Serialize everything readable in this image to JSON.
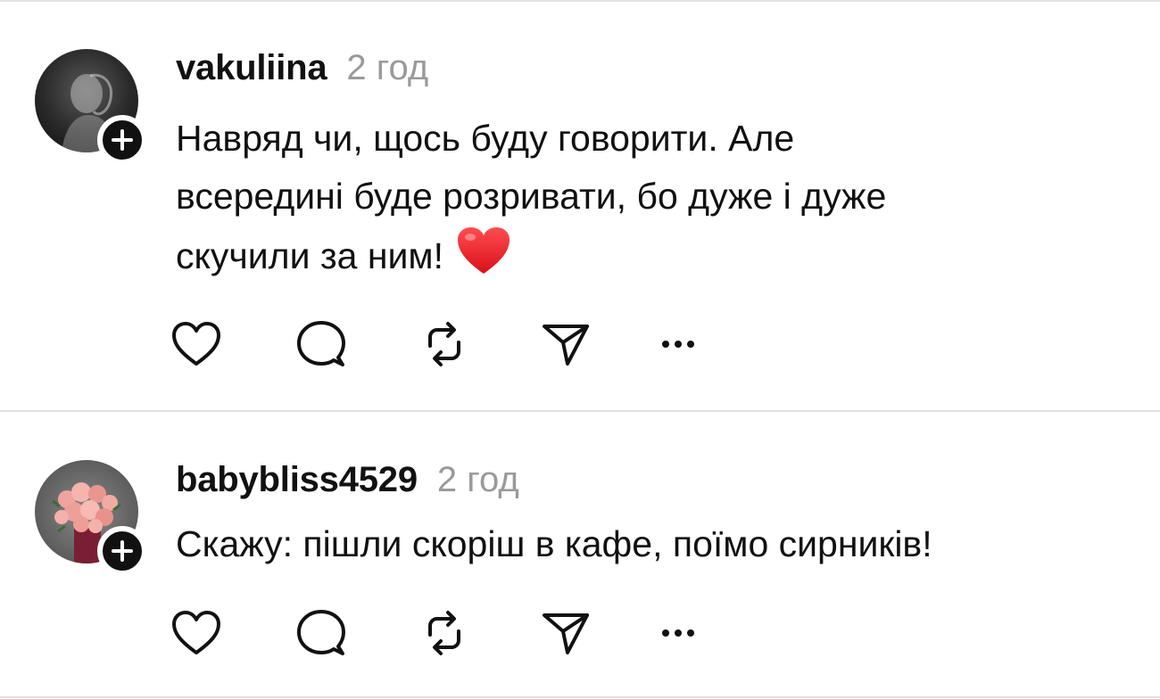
{
  "posts": [
    {
      "username": "vakuliina",
      "time": "2 год",
      "text": "Навряд чи, щось буду говорити. Але\nвсередині буде розривати, бо дуже і дуже\nскучили за ним!",
      "emoji": "heart-emoji",
      "avatar": "avatar-dark-portrait",
      "follow_icon": "plus-icon"
    },
    {
      "username": "babybliss4529",
      "time": "2 год",
      "text": "Скажу: пішли скоріш в кафе, поїмо сирників!",
      "avatar": "avatar-rose-bouquet",
      "follow_icon": "plus-icon"
    }
  ],
  "actions": [
    "heart-icon",
    "reply-bubble-icon",
    "repost-icon",
    "send-icon",
    "more-dots-icon"
  ],
  "colors": {
    "text": "#111111",
    "timestamp": "#9a9a9a",
    "divider": "#e0e0e0",
    "badge": "#111111"
  }
}
